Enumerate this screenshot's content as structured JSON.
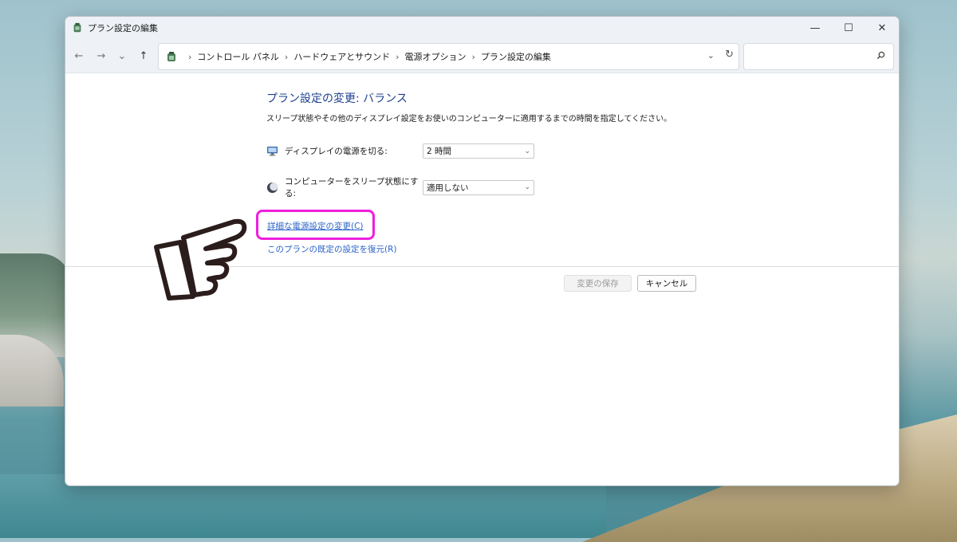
{
  "window": {
    "title": "プラン設定の編集",
    "controls": {
      "minimize": "—",
      "maximize": "☐",
      "close": "✕"
    }
  },
  "navigation": {
    "back": "←",
    "forward": "→",
    "recent": "⌄",
    "up": "↑",
    "breadcrumb": [
      "コントロール パネル",
      "ハードウェアとサウンド",
      "電源オプション",
      "プラン設定の編集"
    ],
    "separator": "›",
    "dropdown": "⌄",
    "refresh": "↻",
    "search_placeholder": ""
  },
  "content": {
    "heading": "プラン設定の変更: バランス",
    "description": "スリープ状態やその他のディスプレイ設定をお使いのコンピューターに適用するまでの時間を指定してください。",
    "display_off": {
      "label": "ディスプレイの電源を切る:",
      "value": "2 時間"
    },
    "sleep": {
      "label": "コンピューターをスリープ状態にする:",
      "value": "適用しない"
    },
    "advanced_link": "詳細な電源設定の変更(C)",
    "restore_link": "このプランの既定の設定を復元(R)",
    "save_button": "変更の保存",
    "cancel_button": "キャンセル"
  },
  "colors": {
    "heading": "#1d3f8f",
    "link": "#2a62c7",
    "highlight": "#ef1fdc"
  }
}
